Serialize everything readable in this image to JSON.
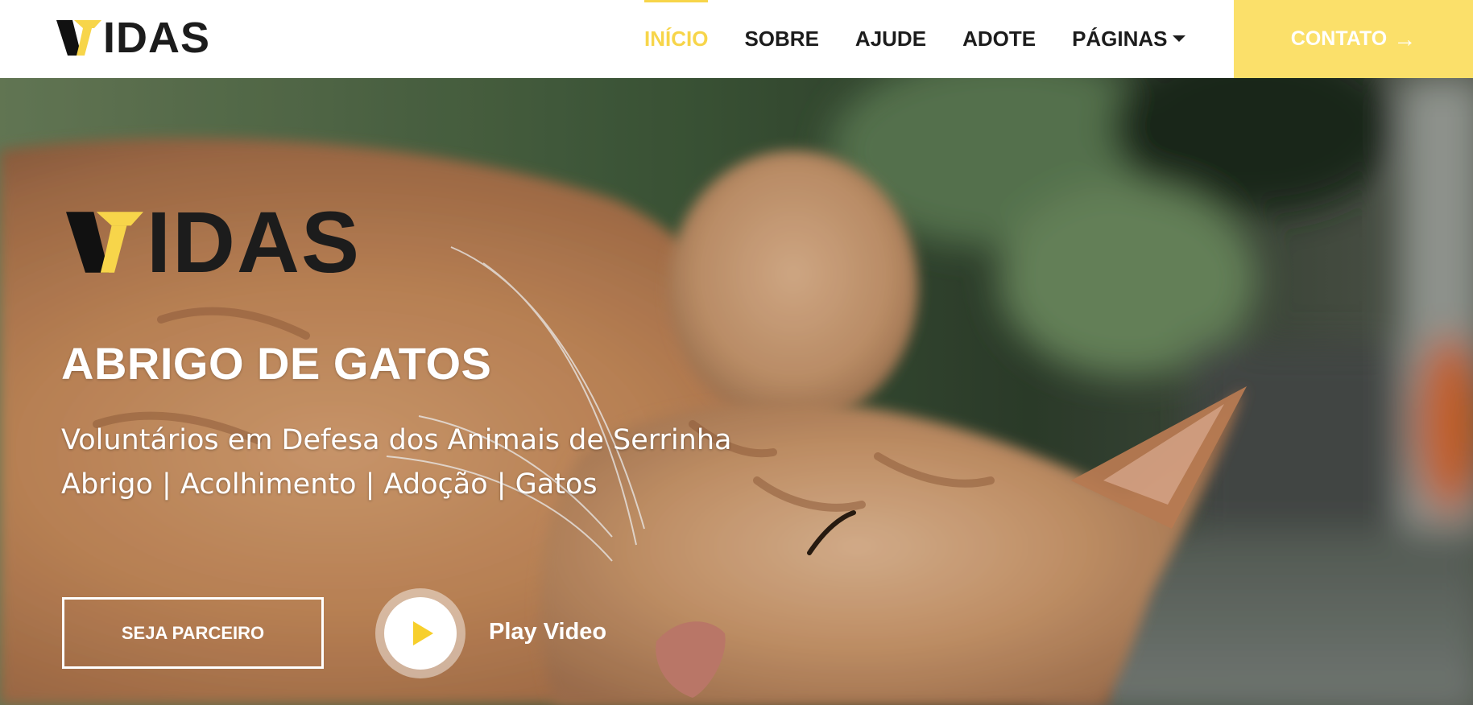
{
  "header": {
    "logo_text": "IDAS",
    "nav": [
      {
        "label": "INÍCIO",
        "active": true
      },
      {
        "label": "SOBRE",
        "active": false
      },
      {
        "label": "AJUDE",
        "active": false
      },
      {
        "label": "ADOTE",
        "active": false
      },
      {
        "label": "PÁGINAS",
        "active": false
      }
    ],
    "contact_label": "CONTATO",
    "contact_icon": "arrow-right-icon"
  },
  "hero": {
    "logo_text": "IDAS",
    "title": "ABRIGO DE GATOS",
    "subtitle_line1": "Voluntários em Defesa dos Animais de Serrinha",
    "subtitle_line2": "Abrigo | Acolhimento | Adoção | Gatos",
    "partner_button": "SEJA PARCEIRO",
    "play_label": "Play Video",
    "background_icon": "orange-cat-photo"
  },
  "colors": {
    "accent": "#f7d54a",
    "contact_bg": "#fbe06a",
    "text_dark": "#1c1c1c"
  }
}
